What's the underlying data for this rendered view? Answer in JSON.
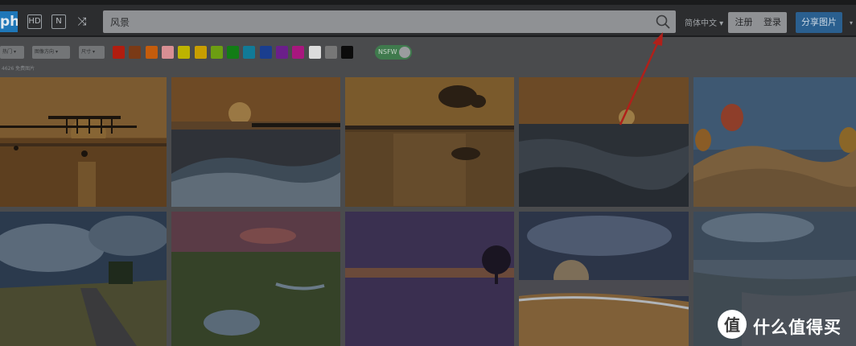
{
  "header": {
    "logo_text": "ph",
    "icons": [
      "hd-icon",
      "n-icon",
      "shuffle-icon"
    ],
    "icon_labels": [
      "HD",
      "N",
      "⤨"
    ],
    "search": {
      "value": "风景",
      "icon": "search-icon"
    },
    "language": "简体中文",
    "register_label": "注册",
    "login_label": "登录",
    "share_label": "分享图片"
  },
  "filters": {
    "sort_label": "热门",
    "orientation_label": "图像方向",
    "size_label": "尺寸",
    "colors": [
      "#b11d0f",
      "#7a3a16",
      "#c45c0c",
      "#d88f93",
      "#bdb400",
      "#c89e00",
      "#6c9e12",
      "#127d16",
      "#117a97",
      "#1a3e8f",
      "#6b1f8a",
      "#a8177e",
      "#dcdcdc",
      "#777777",
      "#0b0b0b"
    ],
    "nsfw_label": "NSFW",
    "result_count": "4626 免费图片"
  },
  "photos": [
    {
      "alt": "sunset pier silhouette"
    },
    {
      "alt": "orange sunset over waves"
    },
    {
      "alt": "golden sunset reflection on beach"
    },
    {
      "alt": "sun on ocean waves tilt shift"
    },
    {
      "alt": "hot air balloons over desert"
    },
    {
      "alt": "country road with rainbow"
    },
    {
      "alt": "marsh meadow at dusk"
    },
    {
      "alt": "lone tree in calm lake"
    },
    {
      "alt": "sunburst over ocean shore"
    },
    {
      "alt": "rocky coast under clouds"
    }
  ],
  "watermark": {
    "text": "什么值得买",
    "icon": "zhi-icon"
  },
  "accent_color": "#1f77b8"
}
